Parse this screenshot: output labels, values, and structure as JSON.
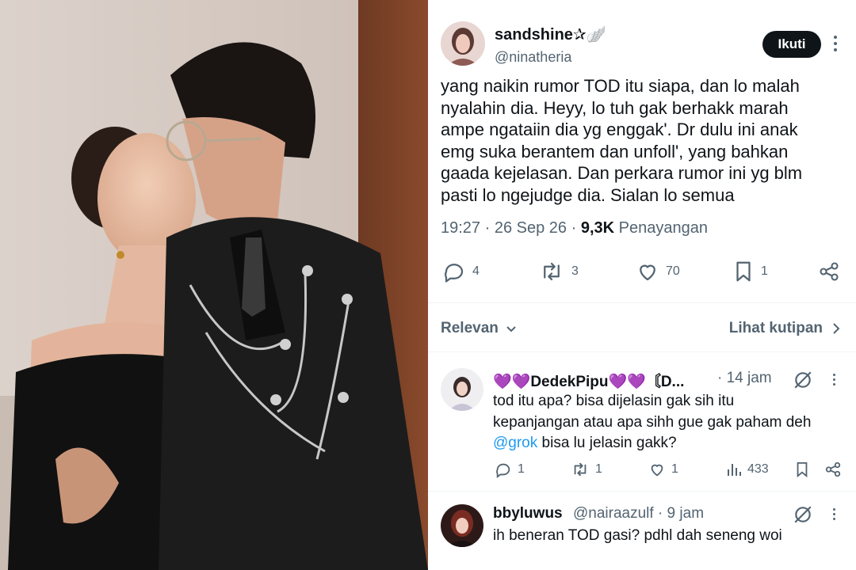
{
  "photo": {
    "description_icon": "couple-photo"
  },
  "post": {
    "display_name": "sandshine✰🪽",
    "handle": "@ninatheria",
    "follow_label": "Ikuti",
    "text_lines": [
      "yang naikin rumor TOD itu siapa, dan lo malah",
      "nyalahin dia. Heyy, lo tuh gak berhakk marah",
      "ampe ngataiin dia yg enggak'. Dr dulu ini anak",
      "emg suka berantem dan unfoll', yang bahkan",
      "gaada kejelasan. Dan perkara rumor ini yg blm",
      "pasti lo ngejudge dia. Sialan lo semua"
    ],
    "time": "19:27",
    "date": "26 Sep 26",
    "views_count": "9,3K",
    "views_label": "Penayangan",
    "replies": "4",
    "reposts": "3",
    "likes": "70",
    "bookmarks": "1"
  },
  "filter": {
    "sort_label": "Relevan",
    "quotes_label": "Lihat kutipan"
  },
  "replies": [
    {
      "name": "💜💜DedekPipu💜💜〘D...",
      "meta": "· 14 jam",
      "lines": [
        "tod itu apa? bisa dijelasin gak sih itu",
        "kepanjangan atau apa sihh gue gak paham deh"
      ],
      "mention": "@grok",
      "mention_rest": " bisa lu jelasin gakk?",
      "replies": "1",
      "reposts": "1",
      "likes": "1",
      "views": "433"
    },
    {
      "name": "bbyluwus",
      "meta": "@nairaazulf · 9 jam",
      "lines": [
        "ih beneran TOD gasi? pdhl dah seneng woi"
      ]
    }
  ],
  "colors": {
    "text": "#0f1419",
    "muted": "#536471",
    "link": "#1d9bf0",
    "divider": "#eff3f4",
    "button": "#0f1419"
  }
}
